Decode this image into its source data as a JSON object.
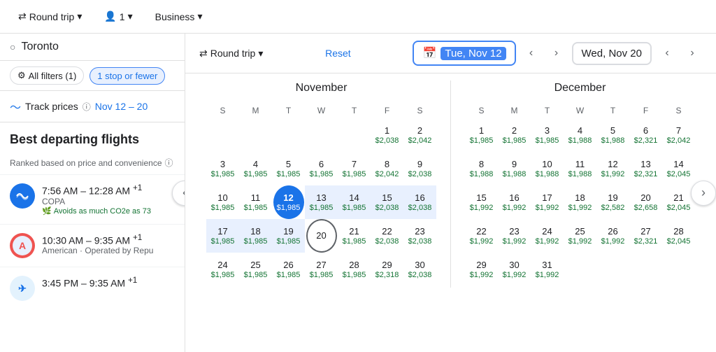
{
  "header": {
    "round_trip_label": "Round trip",
    "passengers_label": "1",
    "class_label": "Business"
  },
  "sidebar": {
    "search_placeholder": "Toronto",
    "filters": {
      "all_filters_label": "All filters (1)",
      "stop_filter_label": "1 stop or fewer"
    },
    "track_prices": {
      "label": "Track prices",
      "dates": "Nov 12 – 20"
    },
    "best_departing_label": "Best departing flights",
    "ranked_label": "Ranked based on price and convenience",
    "flights": [
      {
        "time": "7:56 AM – 12:28 AM",
        "offset": "+1",
        "airline": "COPA",
        "eco": "Avoids as much CO2e as 73"
      },
      {
        "time": "10:30 AM – 9:35 AM",
        "offset": "+1",
        "airline": "American · Operated by Repu"
      },
      {
        "time": "3:45 PM – 9:35 AM",
        "offset": "+1",
        "airline": ""
      }
    ]
  },
  "calendar_header": {
    "round_trip_label": "Round trip",
    "reset_label": "Reset",
    "depart_date": "Tue, Nov 12",
    "return_date": "Wed, Nov 20"
  },
  "november": {
    "title": "November",
    "headers": [
      "S",
      "M",
      "T",
      "W",
      "T",
      "F",
      "S"
    ],
    "weeks": [
      [
        null,
        null,
        null,
        null,
        null,
        {
          "num": "1",
          "price": "$2,038"
        },
        {
          "num": "2",
          "price": "$2,042"
        }
      ],
      [
        {
          "num": "3",
          "price": "$1,985"
        },
        {
          "num": "4",
          "price": "$1,985"
        },
        {
          "num": "5",
          "price": "$1,985"
        },
        {
          "num": "6",
          "price": "$1,985"
        },
        {
          "num": "7",
          "price": "$1,985"
        },
        {
          "num": "8",
          "price": "$2,042"
        },
        {
          "num": "9",
          "price": "$2,038"
        }
      ],
      [
        {
          "num": "10",
          "price": "$1,985"
        },
        {
          "num": "11",
          "price": "$1,985"
        },
        {
          "num": "12",
          "price": "$1,985",
          "selected": true
        },
        {
          "num": "13",
          "price": "$1,985",
          "inrange": true
        },
        {
          "num": "14",
          "price": "$1,985",
          "inrange": true
        },
        {
          "num": "15",
          "price": "$2,038",
          "inrange": true
        },
        {
          "num": "16",
          "price": "$2,038",
          "inrange": true
        }
      ],
      [
        {
          "num": "17",
          "price": "$1,985",
          "inrange": true
        },
        {
          "num": "18",
          "price": "$1,985",
          "inrange": true
        },
        {
          "num": "19",
          "price": "$1,985",
          "inrange": true
        },
        {
          "num": "20",
          "price": "",
          "endselected": true
        },
        {
          "num": "21",
          "price": "$1,985"
        },
        {
          "num": "22",
          "price": "$2,038"
        },
        {
          "num": "23",
          "price": "$2,038"
        }
      ],
      [
        {
          "num": "24",
          "price": "$1,985"
        },
        {
          "num": "25",
          "price": "$1,985"
        },
        {
          "num": "26",
          "price": "$1,985"
        },
        {
          "num": "27",
          "price": "$1,985"
        },
        {
          "num": "28",
          "price": "$1,985"
        },
        {
          "num": "29",
          "price": "$2,318"
        },
        {
          "num": "30",
          "price": "$2,038"
        }
      ]
    ]
  },
  "december": {
    "title": "December",
    "headers": [
      "S",
      "M",
      "T",
      "W",
      "T",
      "F",
      "S"
    ],
    "weeks": [
      [
        {
          "num": "1",
          "price": "$1,985"
        },
        {
          "num": "2",
          "price": "$1,985"
        },
        {
          "num": "3",
          "price": "$1,985"
        },
        {
          "num": "4",
          "price": "$1,988"
        },
        {
          "num": "5",
          "price": "$1,988"
        },
        {
          "num": "6",
          "price": "$2,321"
        },
        {
          "num": "7",
          "price": "$2,042"
        }
      ],
      [
        {
          "num": "8",
          "price": "$1,988"
        },
        {
          "num": "9",
          "price": "$1,988"
        },
        {
          "num": "10",
          "price": "$1,988"
        },
        {
          "num": "11",
          "price": "$1,988"
        },
        {
          "num": "12",
          "price": "$1,992"
        },
        {
          "num": "13",
          "price": "$2,321"
        },
        {
          "num": "14",
          "price": "$2,045"
        }
      ],
      [
        {
          "num": "15",
          "price": "$1,992"
        },
        {
          "num": "16",
          "price": "$1,992"
        },
        {
          "num": "17",
          "price": "$1,992"
        },
        {
          "num": "18",
          "price": "$1,992"
        },
        {
          "num": "19",
          "price": "$2,582"
        },
        {
          "num": "20",
          "price": "$2,658"
        },
        {
          "num": "21",
          "price": "$2,045"
        }
      ],
      [
        {
          "num": "22",
          "price": "$1,992"
        },
        {
          "num": "23",
          "price": "$1,992"
        },
        {
          "num": "24",
          "price": "$1,992"
        },
        {
          "num": "25",
          "price": "$1,992"
        },
        {
          "num": "26",
          "price": "$1,992"
        },
        {
          "num": "27",
          "price": "$2,321"
        },
        {
          "num": "28",
          "price": "$2,045"
        }
      ],
      [
        {
          "num": "29",
          "price": "$1,992"
        },
        {
          "num": "30",
          "price": "$1,992"
        },
        {
          "num": "31",
          "price": "$1,992"
        },
        null,
        null,
        null,
        null
      ]
    ]
  }
}
